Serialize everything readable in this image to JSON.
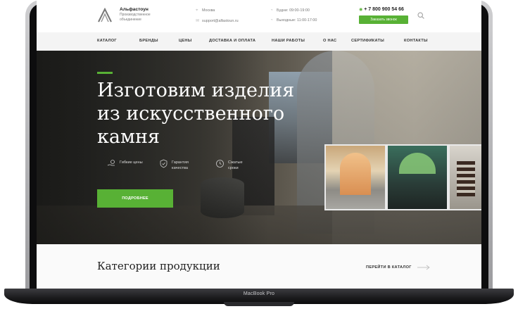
{
  "device": {
    "label": "MacBook Pro"
  },
  "header": {
    "logo_name": "Альфастоун",
    "logo_subtitle": "Производственное объединение",
    "city": "Москва",
    "email": "support@alfastoun.ru",
    "weekdays": "Будни: 09:00-19:00",
    "weekends": "Выходные: 11:00-17:00",
    "phone": "+ 7 800 900 54 66",
    "call_button": "Заказать звонок"
  },
  "nav": {
    "items": [
      "КАТАЛОГ",
      "БРЕНДЫ",
      "ЦЕНЫ",
      "ДОСТАВКА И ОПЛАТА",
      "НАШИ РАБОТЫ",
      "О НАС",
      "СЕРТИФИКАТЫ",
      "КОНТАКТЫ"
    ]
  },
  "hero": {
    "title": "Изготовим изделия из искусственного камня",
    "features": [
      {
        "text": "Гибкие цены",
        "icon": "hand-coins-icon"
      },
      {
        "text": "Гарантия качества",
        "icon": "shield-check-icon"
      },
      {
        "text": "Сжатые сроки",
        "icon": "clock-icon"
      }
    ],
    "button": "ПОДРОБНЕЕ"
  },
  "categories": {
    "title": "Категории продукции",
    "link": "ПЕРЕЙТИ В КАТАЛОГ"
  },
  "colors": {
    "accent": "#58b135",
    "text": "#222222",
    "nav_bg": "#f4f4f4"
  }
}
